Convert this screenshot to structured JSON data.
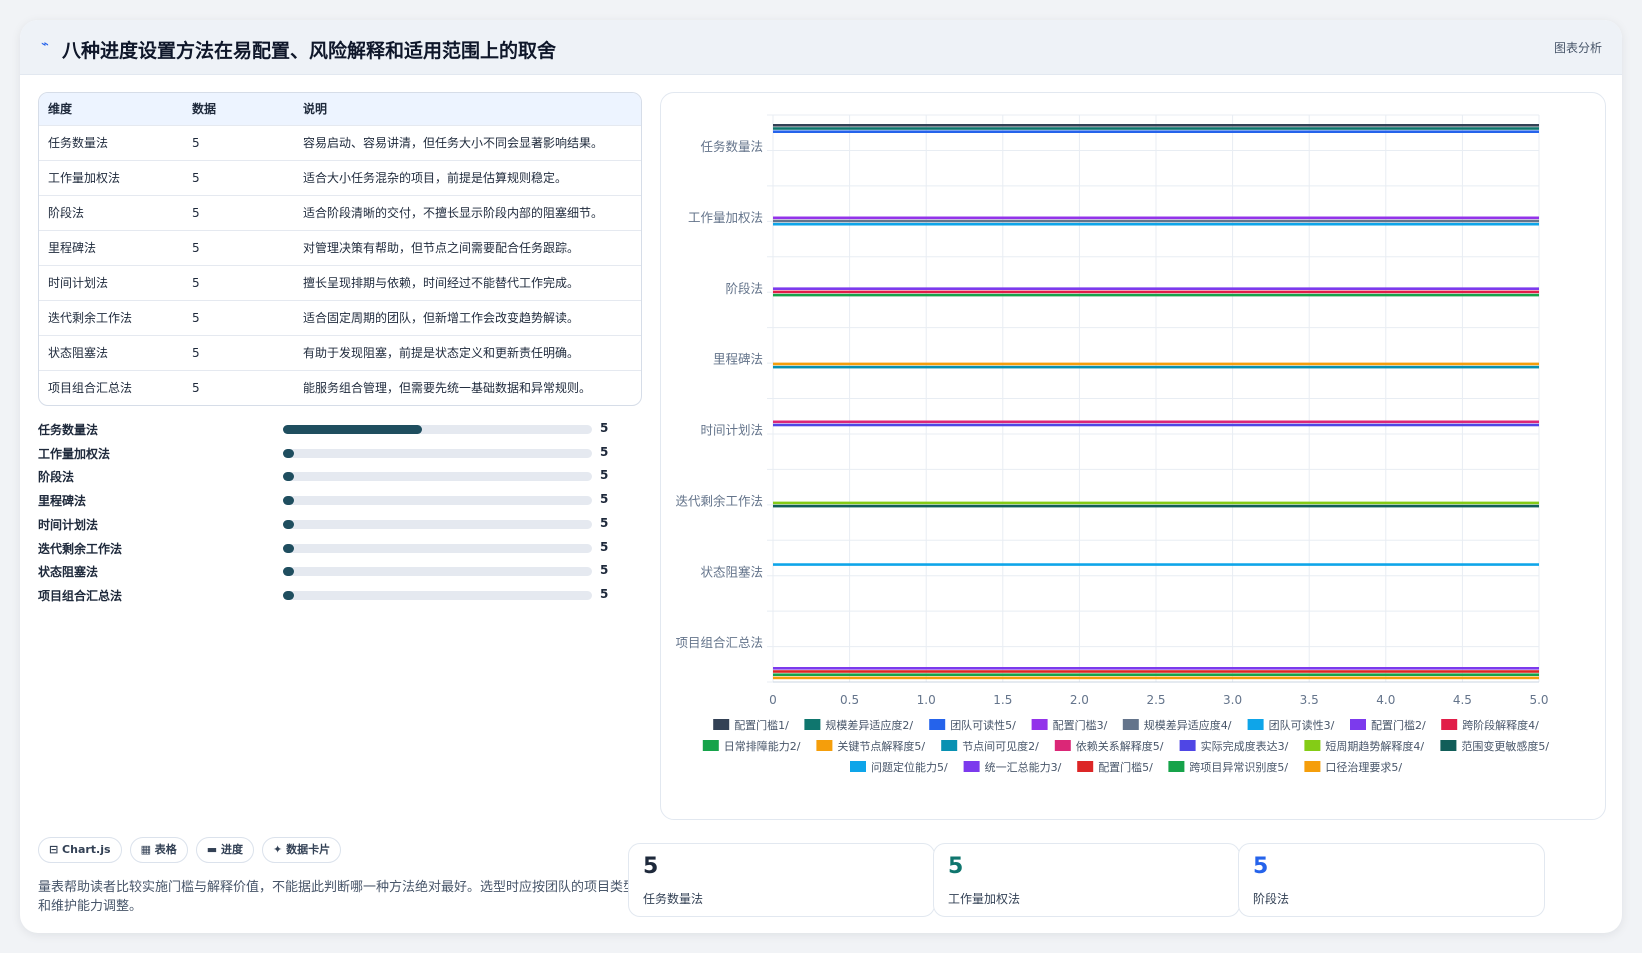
{
  "header": {
    "icon": "chart-icon",
    "title": "八种进度设置方法在易配置、风险解释和适用范围上的取舍",
    "tag": "图表分析"
  },
  "table": {
    "headers": [
      "维度",
      "数据",
      "说明"
    ],
    "rows": [
      {
        "name": "任务数量法",
        "value": "5",
        "desc": "容易启动、容易讲清，但任务大小不同会显著影响结果。"
      },
      {
        "name": "工作量加权法",
        "value": "5",
        "desc": "适合大小任务混杂的项目，前提是估算规则稳定。"
      },
      {
        "name": "阶段法",
        "value": "5",
        "desc": "适合阶段清晰的交付，不擅长显示阶段内部的阻塞细节。"
      },
      {
        "name": "里程碑法",
        "value": "5",
        "desc": "对管理决策有帮助，但节点之间需要配合任务跟踪。"
      },
      {
        "name": "时间计划法",
        "value": "5",
        "desc": "擅长呈现排期与依赖，时间经过不能替代工作完成。"
      },
      {
        "name": "迭代剩余工作法",
        "value": "5",
        "desc": "适合固定周期的团队，但新增工作会改变趋势解读。"
      },
      {
        "name": "状态阻塞法",
        "value": "5",
        "desc": "有助于发现阻塞，前提是状态定义和更新责任明确。"
      },
      {
        "name": "项目组合汇总法",
        "value": "5",
        "desc": "能服务组合管理，但需要先统一基础数据和异常规则。"
      }
    ]
  },
  "progress": [
    {
      "label": "任务数量法",
      "value": "5",
      "fraction": 0.45
    },
    {
      "label": "工作量加权法",
      "value": "5",
      "fraction": 0
    },
    {
      "label": "阶段法",
      "value": "5",
      "fraction": 0
    },
    {
      "label": "里程碑法",
      "value": "5",
      "fraction": 0
    },
    {
      "label": "时间计划法",
      "value": "5",
      "fraction": 0
    },
    {
      "label": "迭代剩余工作法",
      "value": "5",
      "fraction": 0
    },
    {
      "label": "状态阻塞法",
      "value": "5",
      "fraction": 0
    },
    {
      "label": "项目组合汇总法",
      "value": "5",
      "fraction": 0
    }
  ],
  "chips": [
    {
      "icon": "chart-icon",
      "label": "Chart.js"
    },
    {
      "icon": "table-icon",
      "label": "表格"
    },
    {
      "icon": "progress-icon",
      "label": "进度"
    },
    {
      "icon": "sparkle-icon",
      "label": "数据卡片"
    }
  ],
  "chip_icons": [
    "⊟",
    "▦",
    "▬",
    "✦"
  ],
  "note": "量表帮助读者比较实施门槛与解释价值，不能据此判断哪一种方法绝对最好。选型时应按团队的项目类型和维护能力调整。",
  "kpis": [
    {
      "value": "5",
      "label": "任务数量法",
      "color": "#1e293b"
    },
    {
      "value": "5",
      "label": "工作量加权法",
      "color": "#0f766e"
    },
    {
      "value": "5",
      "label": "阶段法",
      "color": "#2563eb"
    }
  ],
  "chart_data": {
    "type": "bar",
    "orientation": "horizontal",
    "categories": [
      "任务数量法",
      "工作量加权法",
      "阶段法",
      "里程碑法",
      "时间计划法",
      "迭代剩余工作法",
      "状态阻塞法",
      "项目组合汇总法"
    ],
    "xlim": [
      0,
      5.0
    ],
    "xticks": [
      "0",
      "0.5",
      "1.0",
      "1.5",
      "2.0",
      "2.5",
      "3.0",
      "3.5",
      "4.0",
      "4.5",
      "5.0"
    ],
    "grid": true,
    "legend_position": "bottom",
    "series": [
      {
        "name": "配置门槛1/",
        "color": "#334155",
        "values": [
          5,
          null,
          null,
          null,
          null,
          null,
          null,
          null
        ]
      },
      {
        "name": "规模差异适应度2/",
        "color": "#0f766e",
        "values": [
          5,
          null,
          null,
          null,
          null,
          null,
          null,
          null
        ]
      },
      {
        "name": "团队可读性5/",
        "color": "#2563eb",
        "values": [
          5,
          null,
          null,
          null,
          null,
          null,
          null,
          null
        ]
      },
      {
        "name": "配置门槛3/",
        "color": "#9333ea",
        "values": [
          null,
          5,
          null,
          null,
          null,
          null,
          null,
          null
        ]
      },
      {
        "name": "规模差异适应度4/",
        "color": "#64748b",
        "values": [
          null,
          5,
          null,
          null,
          null,
          null,
          null,
          null
        ]
      },
      {
        "name": "团队可读性3/",
        "color": "#0ea5e9",
        "values": [
          null,
          5,
          null,
          null,
          null,
          null,
          null,
          null
        ]
      },
      {
        "name": "配置门槛2/",
        "color": "#7c3aed",
        "values": [
          null,
          null,
          5,
          null,
          null,
          null,
          null,
          null
        ]
      },
      {
        "name": "跨阶段解释度4/",
        "color": "#e11d48",
        "values": [
          null,
          null,
          5,
          null,
          null,
          null,
          null,
          null
        ]
      },
      {
        "name": "日常排障能力2/",
        "color": "#16a34a",
        "values": [
          null,
          null,
          5,
          null,
          null,
          null,
          null,
          null
        ]
      },
      {
        "name": "关键节点解释度5/",
        "color": "#f59e0b",
        "values": [
          null,
          null,
          null,
          5,
          null,
          null,
          null,
          null
        ]
      },
      {
        "name": "节点间可见度2/",
        "color": "#0891b2",
        "values": [
          null,
          null,
          null,
          5,
          null,
          null,
          null,
          null
        ]
      },
      {
        "name": "依赖关系解释度5/",
        "color": "#db2777",
        "values": [
          null,
          null,
          null,
          null,
          5,
          null,
          null,
          null
        ]
      },
      {
        "name": "实际完成度表达3/",
        "color": "#4f46e5",
        "values": [
          null,
          null,
          null,
          null,
          5,
          null,
          null,
          null
        ]
      },
      {
        "name": "短周期趋势解释度4/",
        "color": "#84cc16",
        "values": [
          null,
          null,
          null,
          null,
          null,
          5,
          null,
          null
        ]
      },
      {
        "name": "范围变更敏感度5/",
        "color": "#115e59",
        "values": [
          null,
          null,
          null,
          null,
          null,
          5,
          null,
          null
        ]
      },
      {
        "name": "问题定位能力5/",
        "color": "#0ea5e9",
        "values": [
          null,
          null,
          null,
          null,
          null,
          null,
          5,
          null
        ]
      },
      {
        "name": "统一汇总能力3/",
        "color": "#7c3aed",
        "values": [
          null,
          null,
          null,
          null,
          null,
          null,
          null,
          5
        ]
      },
      {
        "name": "配置门槛5/",
        "color": "#dc2626",
        "values": [
          null,
          null,
          null,
          null,
          null,
          null,
          null,
          5
        ]
      },
      {
        "name": "跨项目异常识别度5/",
        "color": "#16a34a",
        "values": [
          null,
          null,
          null,
          null,
          null,
          null,
          null,
          5
        ]
      },
      {
        "name": "口径治理要求5/",
        "color": "#f59e0b",
        "values": [
          null,
          null,
          null,
          null,
          null,
          null,
          null,
          5
        ]
      }
    ]
  }
}
